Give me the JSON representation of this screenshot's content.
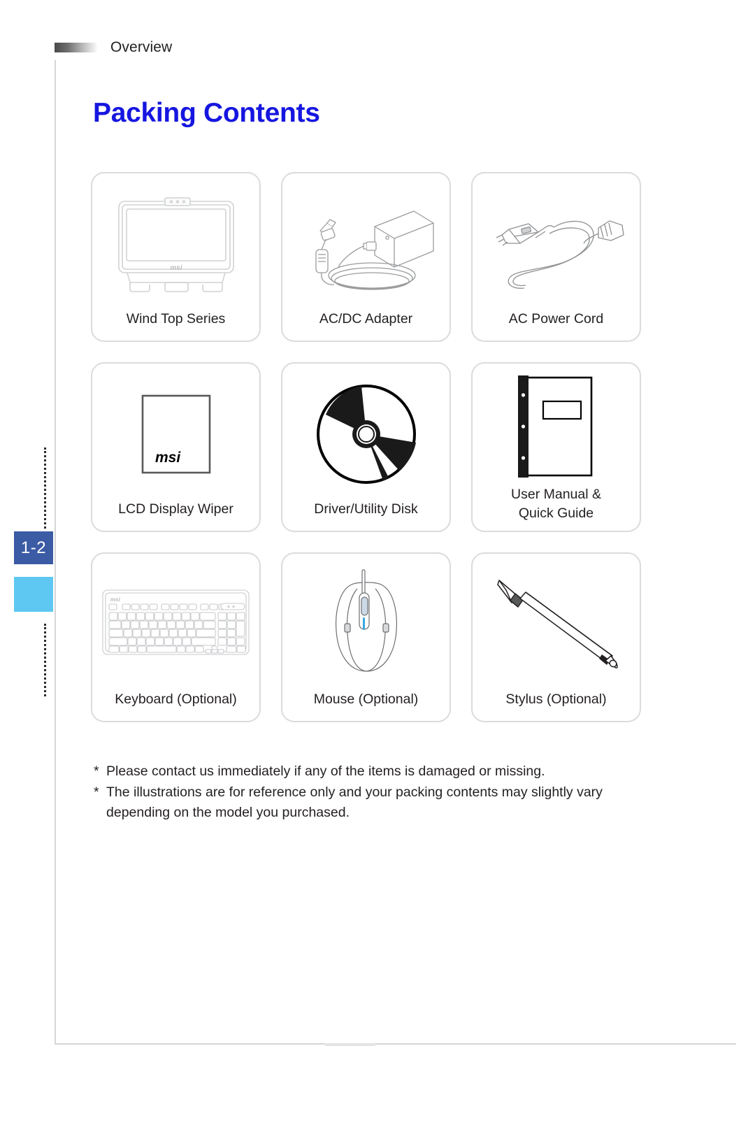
{
  "header": {
    "section_label": "Overview"
  },
  "sidebar": {
    "page_number": "1-2",
    "tab_color": "#3b5ba5",
    "chapter_color": "#5fc8f2"
  },
  "main": {
    "title": "Packing Contents",
    "title_color": "#1616e0",
    "items": [
      {
        "label": "Wind Top Series",
        "icon": "all-in-one-pc-icon",
        "brand": "msi"
      },
      {
        "label": "AC/DC Adapter",
        "icon": "ac-dc-adapter-icon"
      },
      {
        "label": "AC Power Cord",
        "icon": "ac-power-cord-icon"
      },
      {
        "label": "LCD Display Wiper",
        "icon": "lcd-display-wiper-icon",
        "brand": "msi"
      },
      {
        "label": "Driver/Utility Disk",
        "icon": "optical-disc-icon"
      },
      {
        "label": "User Manual &\nQuick Guide",
        "label_line1": "User Manual &",
        "label_line2": "Quick Guide",
        "icon": "user-manual-icon"
      },
      {
        "label": "Keyboard (Optional)",
        "icon": "keyboard-icon",
        "brand": "msi"
      },
      {
        "label": "Mouse (Optional)",
        "icon": "mouse-icon"
      },
      {
        "label": "Stylus (Optional)",
        "icon": "stylus-icon"
      }
    ],
    "notes": [
      {
        "marker": "*",
        "text": "Please contact us immediately if any of the items is damaged or missing."
      },
      {
        "marker": "*",
        "text": "The illustrations are for reference only and your packing contents may slightly vary",
        "continuation": "depending on the model you purchased."
      }
    ]
  }
}
